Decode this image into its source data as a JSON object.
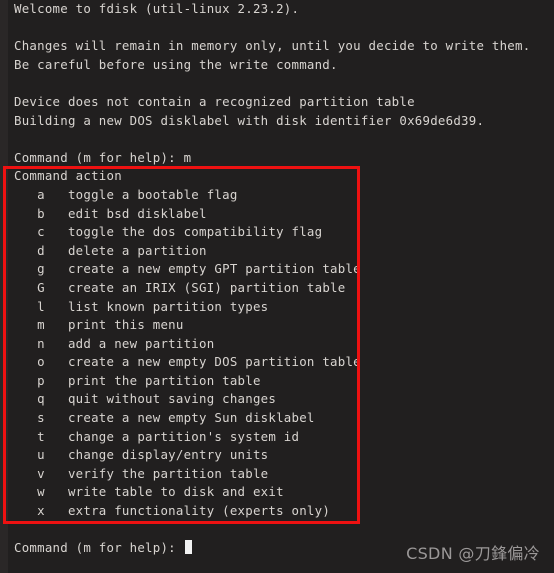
{
  "terminal": {
    "intro_lines": [
      "Welcome to fdisk (util-linux 2.23.2).",
      "",
      "Changes will remain in memory only, until you decide to write them.",
      "Be careful before using the write command.",
      "",
      "Device does not contain a recognized partition table",
      "Building a new DOS disklabel with disk identifier 0x69de6d39.",
      ""
    ],
    "prompt_with_input": "Command (m for help): m",
    "menu_header": "Command action",
    "menu_items": [
      {
        "key": "a",
        "description": "toggle a bootable flag"
      },
      {
        "key": "b",
        "description": "edit bsd disklabel"
      },
      {
        "key": "c",
        "description": "toggle the dos compatibility flag"
      },
      {
        "key": "d",
        "description": "delete a partition"
      },
      {
        "key": "g",
        "description": "create a new empty GPT partition table"
      },
      {
        "key": "G",
        "description": "create an IRIX (SGI) partition table"
      },
      {
        "key": "l",
        "description": "list known partition types"
      },
      {
        "key": "m",
        "description": "print this menu"
      },
      {
        "key": "n",
        "description": "add a new partition"
      },
      {
        "key": "o",
        "description": "create a new empty DOS partition table"
      },
      {
        "key": "p",
        "description": "print the partition table"
      },
      {
        "key": "q",
        "description": "quit without saving changes"
      },
      {
        "key": "s",
        "description": "create a new empty Sun disklabel"
      },
      {
        "key": "t",
        "description": "change a partition's system id"
      },
      {
        "key": "u",
        "description": "change display/entry units"
      },
      {
        "key": "v",
        "description": "verify the partition table"
      },
      {
        "key": "w",
        "description": "write table to disk and exit"
      },
      {
        "key": "x",
        "description": "extra functionality (experts only)"
      }
    ],
    "final_prompt": "Command (m for help): ",
    "colors": {
      "background": "#211f1f",
      "text": "#d8d4d0",
      "highlight_box": "#ee1111",
      "cursor": "#f2f2f2"
    }
  },
  "watermark": {
    "text": "CSDN @刀鋒偏冷"
  }
}
